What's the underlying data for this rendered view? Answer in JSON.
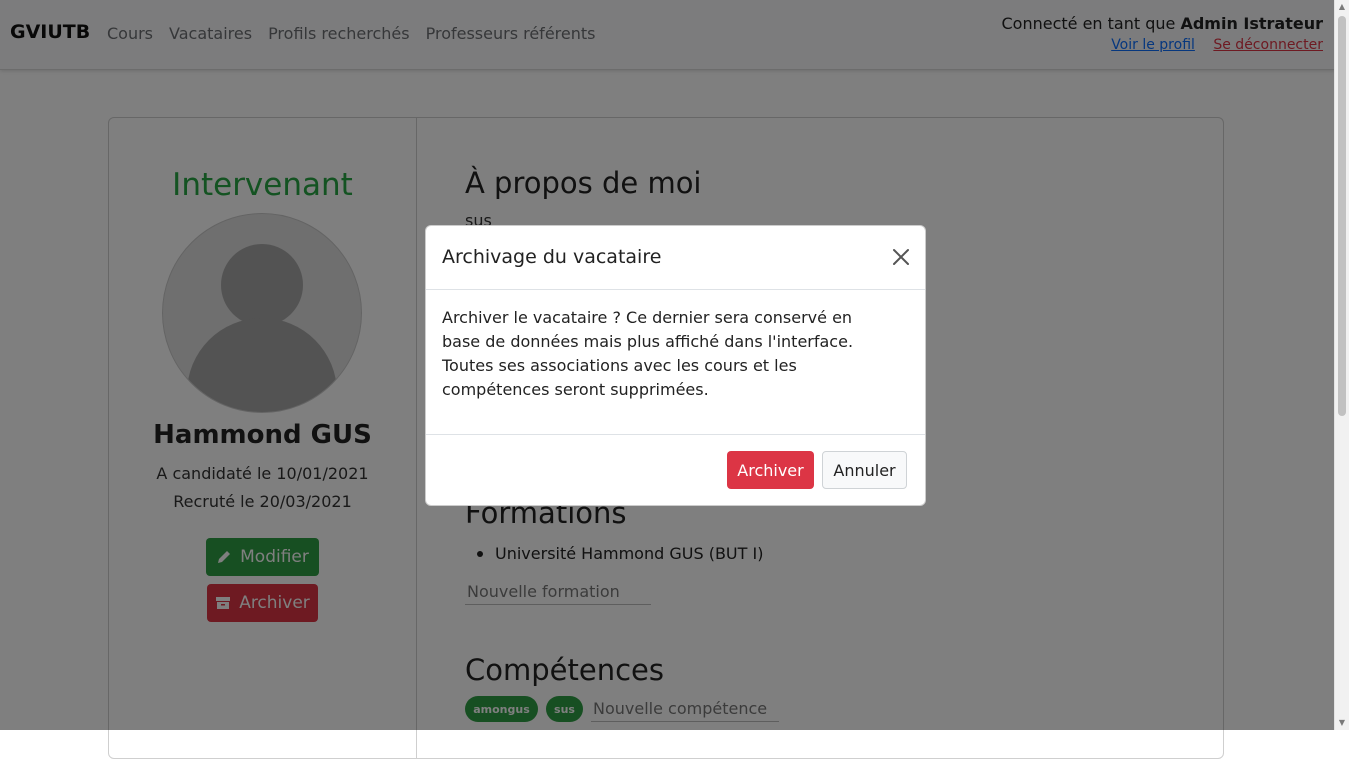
{
  "navbar": {
    "brand": "GVIUTB",
    "links": [
      "Cours",
      "Vacataires",
      "Profils recherchés",
      "Professeurs référents"
    ],
    "user_prefix": "Connecté en tant que",
    "user_name": "Admin Istrateur",
    "profile_link": "Voir le profil",
    "logout_link": "Se déconnecter"
  },
  "profile": {
    "role": "Intervenant",
    "name": "Hammond GUS",
    "applied": "A candidaté le 10/01/2021",
    "recruited": "Recruté le 20/03/2021",
    "edit_label": "Modifier",
    "archive_label": "Archiver"
  },
  "about": {
    "title": "À propos de moi",
    "text": "sus"
  },
  "formations": {
    "title": "Formations",
    "items": [
      "Université Hammond GUS (BUT I)"
    ],
    "placeholder": "Nouvelle formation"
  },
  "skills": {
    "title": "Compétences",
    "badges": [
      "amongus",
      "sus"
    ],
    "placeholder": "Nouvelle compétence"
  },
  "modal": {
    "title": "Archivage du vacataire",
    "body": "Archiver le vacataire ? Ce dernier sera conservé en base de données mais plus affiché dans l'interface. Toutes ses associations avec les cours et les compétences seront supprimées.",
    "confirm_label": "Archiver",
    "cancel_label": "Annuler"
  },
  "colors": {
    "accent_green": "#28a745",
    "danger_red": "#dc3545",
    "link_blue": "#0d6efd"
  }
}
